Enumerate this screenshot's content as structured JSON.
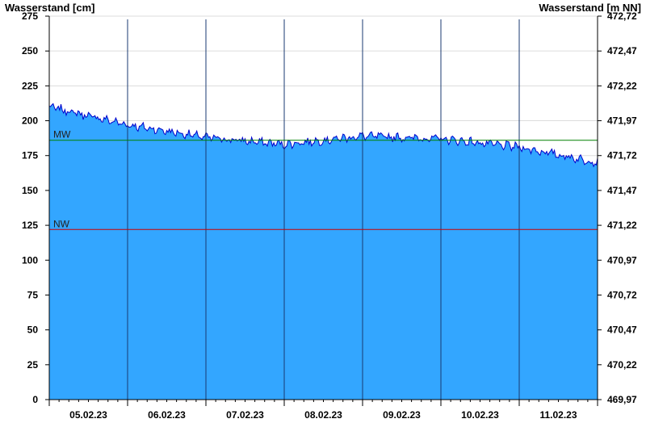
{
  "chart_data": {
    "type": "area",
    "ylabel_left": "Wasserstand [cm]",
    "ylabel_right": "Wasserstand [m NN]",
    "y_ticks_left": [
      "0",
      "25",
      "50",
      "75",
      "100",
      "125",
      "150",
      "175",
      "200",
      "225",
      "250",
      "275"
    ],
    "y_ticks_right": [
      "469,97",
      "470,22",
      "470,47",
      "470,72",
      "470,97",
      "471,22",
      "471,47",
      "471,72",
      "471,97",
      "472,22",
      "472,47",
      "472,72"
    ],
    "ylim": [
      0,
      275
    ],
    "x_labels": [
      "05.02.23",
      "06.02.23",
      "07.02.23",
      "08.02.23",
      "09.02.23",
      "10.02.23",
      "11.02.23"
    ],
    "day_count": 7,
    "grid": true,
    "reference_lines": [
      {
        "name": "MW",
        "value": 186,
        "color": "#008000"
      },
      {
        "name": "NW",
        "value": 122,
        "color": "#cc0000"
      }
    ],
    "series": [
      {
        "values_daily_start": [
          210,
          197,
          188,
          183,
          189,
          187,
          181,
          170
        ],
        "fill_color": "#33a6ff",
        "line_color": "#0000cc"
      }
    ]
  }
}
